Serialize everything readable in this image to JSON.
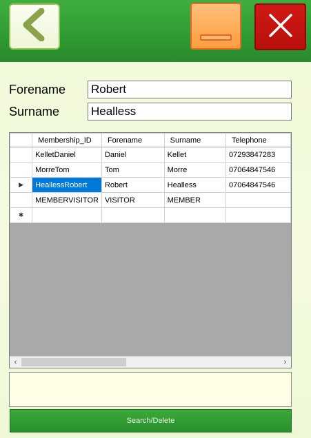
{
  "form": {
    "forename_label": "Forename",
    "forename_value": "Robert",
    "surname_label": "Surname",
    "surname_value": "Healless"
  },
  "grid": {
    "columns": [
      "Membership_ID",
      "Forename",
      "Surname",
      "Telephone"
    ],
    "rows": [
      {
        "id": "KelletDaniel",
        "forename": "Daniel",
        "surname": "Kellet",
        "telephone": "07293847283"
      },
      {
        "id": "MorreTom",
        "forename": "Tom",
        "surname": "Morre",
        "telephone": "07064847546"
      },
      {
        "id": "HeallessRobert",
        "forename": "Robert",
        "surname": "Healless",
        "telephone": "07064847546"
      },
      {
        "id": "MEMBERVISITOR",
        "forename": "VISITOR",
        "surname": "MEMBER",
        "telephone": ""
      }
    ],
    "current_row_marker": "▶",
    "new_row_marker": "✱"
  },
  "buttons": {
    "search_delete_label": "Search/Delete",
    "back_icon": "chevron-left-icon",
    "minimize_icon": "minimize-icon",
    "close_icon": "close-icon"
  },
  "colors": {
    "header_green": "#2f9a32",
    "selection_blue": "#0078d7",
    "minimize_orange": "#ff9d3f",
    "close_red": "#c0120e"
  }
}
